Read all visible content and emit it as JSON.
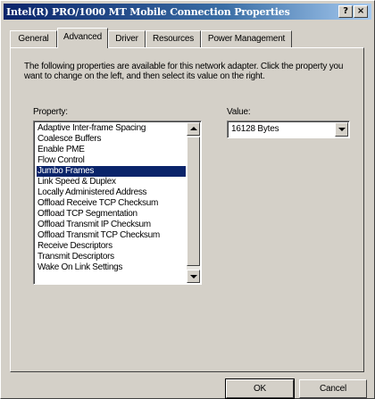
{
  "window": {
    "title": "Intel(R) PRO/1000 MT Mobile Connection Properties",
    "help_label": "?",
    "close_label": "×"
  },
  "tabs": [
    {
      "label": "General",
      "active": false
    },
    {
      "label": "Advanced",
      "active": true
    },
    {
      "label": "Driver",
      "active": false
    },
    {
      "label": "Resources",
      "active": false
    },
    {
      "label": "Power Management",
      "active": false
    }
  ],
  "advanced": {
    "description": "The following properties are available for this network adapter. Click the property you want to change on the left, and then select its value on the right.",
    "property_label": "Property:",
    "value_label": "Value:",
    "properties": [
      "Adaptive Inter-frame Spacing",
      "Coalesce Buffers",
      "Enable PME",
      "Flow Control",
      "Jumbo Frames",
      "Link Speed & Duplex",
      "Locally Administered Address",
      "Offload Receive TCP Checksum",
      "Offload TCP Segmentation",
      "Offload Transmit IP Checksum",
      "Offload Transmit TCP Checksum",
      "Receive Descriptors",
      "Transmit Descriptors",
      "Wake On Link Settings"
    ],
    "selected_property": "Jumbo Frames",
    "value": "16128 Bytes"
  },
  "buttons": {
    "ok": "OK",
    "cancel": "Cancel"
  },
  "colors": {
    "title_bar_start": "#0a246a",
    "title_bar_end": "#a6caf0",
    "selection": "#0a246a",
    "face": "#d4d0c8"
  }
}
